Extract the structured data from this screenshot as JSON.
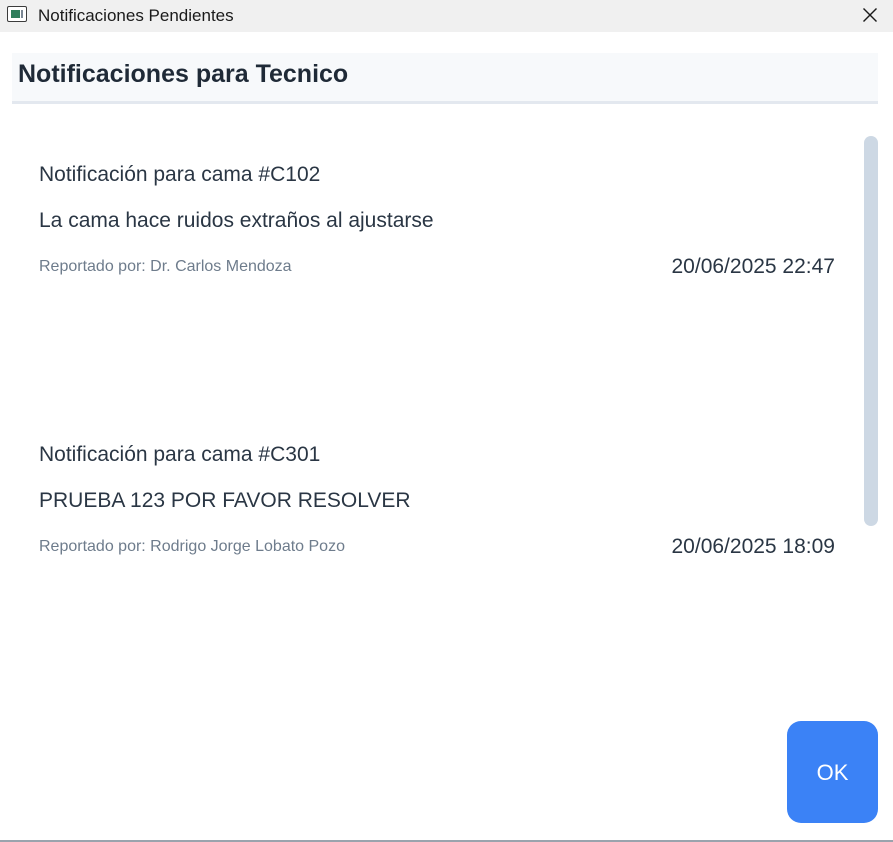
{
  "window": {
    "title": "Notificaciones Pendientes"
  },
  "header": {
    "title": "Notificaciones para Tecnico"
  },
  "notifications": [
    {
      "title": "Notificación para cama #C102",
      "message": "La cama hace ruidos extraños al ajustarse",
      "reporter": "Reportado por: Dr. Carlos Mendoza",
      "datetime": "20/06/2025 22:47"
    },
    {
      "title": "Notificación para cama #C301",
      "message": "PRUEBA 123 POR FAVOR RESOLVER",
      "reporter": "Reportado por: Rodrigo Jorge Lobato Pozo",
      "datetime": "20/06/2025 18:09"
    }
  ],
  "footer": {
    "ok_label": "OK"
  },
  "colors": {
    "accent": "#3b82f6",
    "header_bg": "#f7f9fb",
    "text_primary": "#2a3644",
    "text_secondary": "#6e7c8c",
    "scrollbar": "#cdd8e4"
  },
  "icons": {
    "app": "window-app-icon",
    "close": "close-icon"
  }
}
